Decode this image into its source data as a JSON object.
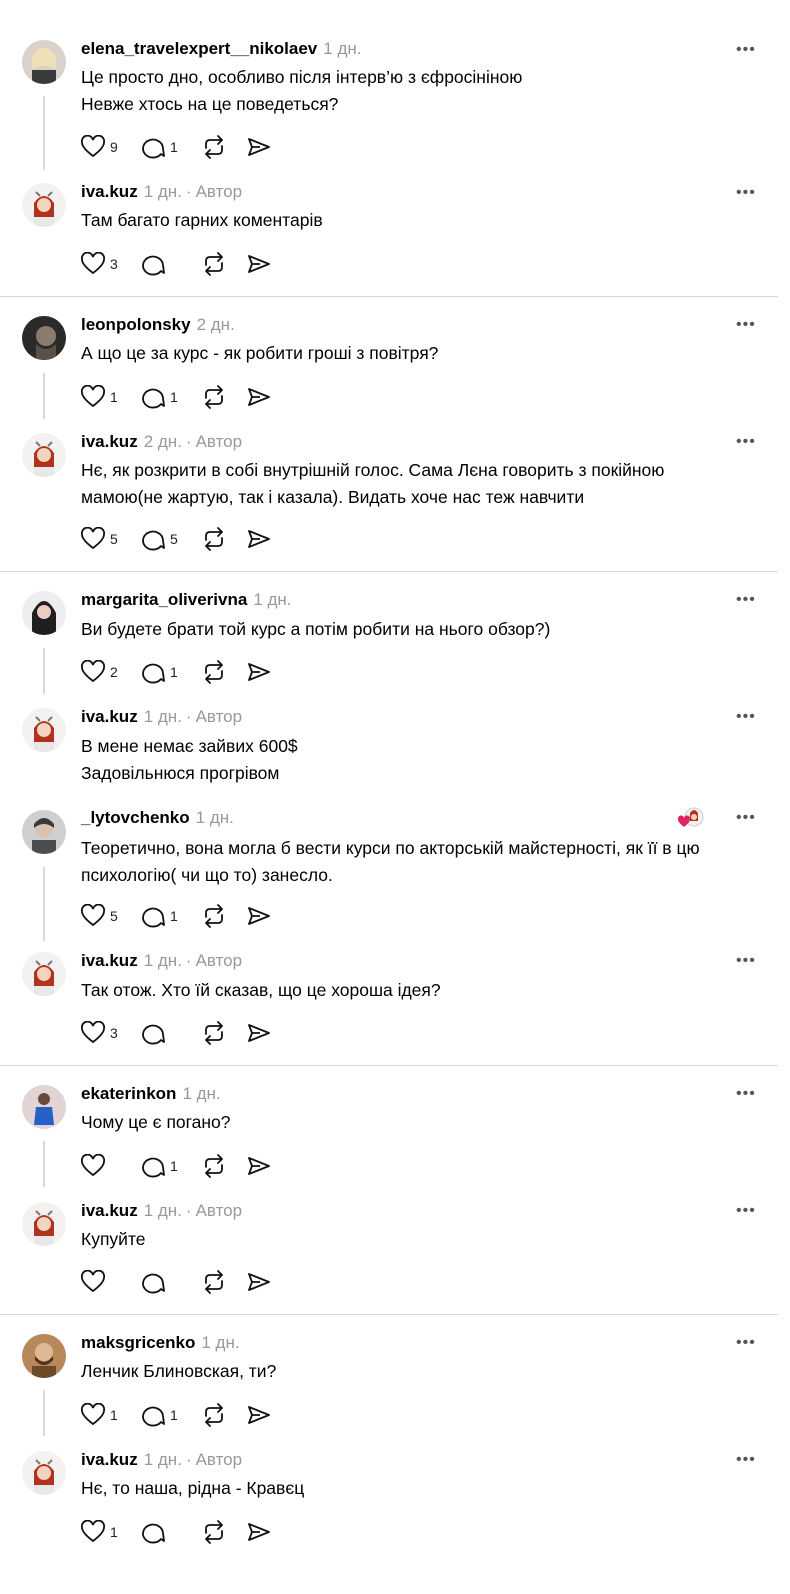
{
  "threads": [
    {
      "comment": {
        "user": "elena_travelexpert__nikolaev",
        "time": "1 дн.",
        "lines": [
          "Це просто дно, особливо після інтерв’ю з єфросініною",
          "Невже хтось на це поведеться?"
        ],
        "likes": "9",
        "replies": "1"
      },
      "reply": {
        "user": "iva.kuz",
        "time": "1 дн.",
        "author": "Автор",
        "lines": [
          "Там багато гарних коментарів"
        ],
        "likes": "3",
        "replies": ""
      }
    },
    {
      "comment": {
        "user": "leonpolonsky",
        "time": "2 дн.",
        "lines": [
          "А що це за курс - як робити гроші з повітря?"
        ],
        "likes": "1",
        "replies": "1"
      },
      "reply": {
        "user": "iva.kuz",
        "time": "2 дн.",
        "author": "Автор",
        "lines": [
          "Нє, як розкрити в собі внутрішній голос. Сама Лєна говорить з покійною",
          "мамою(не жартую, так і казала). Видать хоче нас теж навчити"
        ],
        "likes": "5",
        "replies": "5"
      }
    },
    {
      "comment": {
        "user": "margarita_oliverivna",
        "time": "1 дн.",
        "lines": [
          "Ви будете брати той курс а потім робити на нього обзор?)"
        ],
        "likes": "2",
        "replies": "1"
      },
      "reply": {
        "user": "iva.kuz",
        "time": "1 дн.",
        "author": "Автор",
        "lines": [
          "В мене немає зайвих 600$",
          "Задовільнюся прогрівом"
        ]
      },
      "reply2": {
        "user": "_lytovchenko",
        "time": "1 дн.",
        "lines": [
          "Теоретично, вона могла б вести курси по акторській майстерності, як її в цю",
          "психологію( чи що то) занесло."
        ],
        "likes": "5",
        "replies": "1"
      },
      "reply3": {
        "user": "iva.kuz",
        "time": "1 дн.",
        "author": "Автор",
        "lines": [
          "Так отож. Хто їй сказав, що це хороша ідея?"
        ],
        "likes": "3",
        "replies": ""
      }
    },
    {
      "comment": {
        "user": "ekaterinkon",
        "time": "1 дн.",
        "lines": [
          "Чому це є погано?"
        ],
        "likes": "",
        "replies": "1"
      },
      "reply": {
        "user": "iva.kuz",
        "time": "1 дн.",
        "author": "Автор",
        "lines": [
          "Купуйте"
        ],
        "likes": "",
        "replies": ""
      }
    },
    {
      "comment": {
        "user": "maksgricenko",
        "time": "1 дн.",
        "lines": [
          "Ленчик Блиновская, ти?"
        ],
        "likes": "1",
        "replies": "1"
      },
      "reply": {
        "user": "iva.kuz",
        "time": "1 дн.",
        "author": "Автор",
        "lines": [
          "Нє, то наша, рідна - Кравєц"
        ],
        "likes": "1",
        "replies": ""
      }
    }
  ],
  "more_glyph": "•••",
  "icons": {
    "like": "heart-icon",
    "reply": "comment-bubble-icon",
    "repost": "repost-icon",
    "share": "send-icon",
    "more": "more-icon"
  },
  "colors": {
    "meta": "#999999",
    "divider": "#d6d6d6",
    "liked_heart": "#e0245e"
  }
}
